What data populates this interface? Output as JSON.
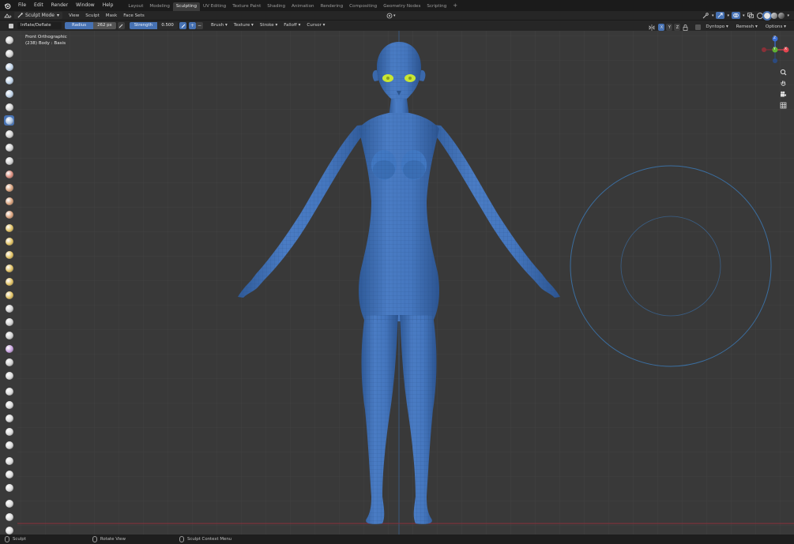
{
  "top_menu": {
    "items": [
      "File",
      "Edit",
      "Render",
      "Window",
      "Help"
    ]
  },
  "workspaces": {
    "tabs": [
      "Layout",
      "Modeling",
      "Sculpting",
      "UV Editing",
      "Texture Paint",
      "Shading",
      "Animation",
      "Rendering",
      "Compositing",
      "Geometry Nodes",
      "Scripting"
    ],
    "active": "Sculpting",
    "add_label": "+"
  },
  "header": {
    "mode": "Sculpt Mode",
    "menus": [
      "View",
      "Sculpt",
      "Mask",
      "Face Sets"
    ]
  },
  "tool_header": {
    "brush_name": "Inflate/Deflate",
    "radius_label": "Radius",
    "radius_value": "262 px",
    "strength_label": "Strength",
    "strength_value": "0.500",
    "plus_label": "+",
    "minus_label": "−",
    "dropdowns": [
      "Brush",
      "Texture",
      "Stroke",
      "Falloff",
      "Cursor"
    ],
    "x_label": "X",
    "y_label": "Y",
    "z_label": "Z",
    "dyntopo_label": "Dyntopo",
    "remesh_label": "Remesh",
    "options_label": "Options"
  },
  "viewport": {
    "view_name": "Front Orthographic",
    "object_info": "(238) Body : Basis",
    "gizmo": {
      "x_label": "X",
      "y_label": "Y",
      "z_label": "Z"
    }
  },
  "status_bar": {
    "items": [
      "Sculpt",
      "Rotate View",
      "Sculpt Context Menu"
    ]
  },
  "colors": {
    "mesh": "#3f6fb8",
    "active_tool": "#4772b3",
    "viewport_bg": "#393939",
    "eye": "#c8e632"
  }
}
